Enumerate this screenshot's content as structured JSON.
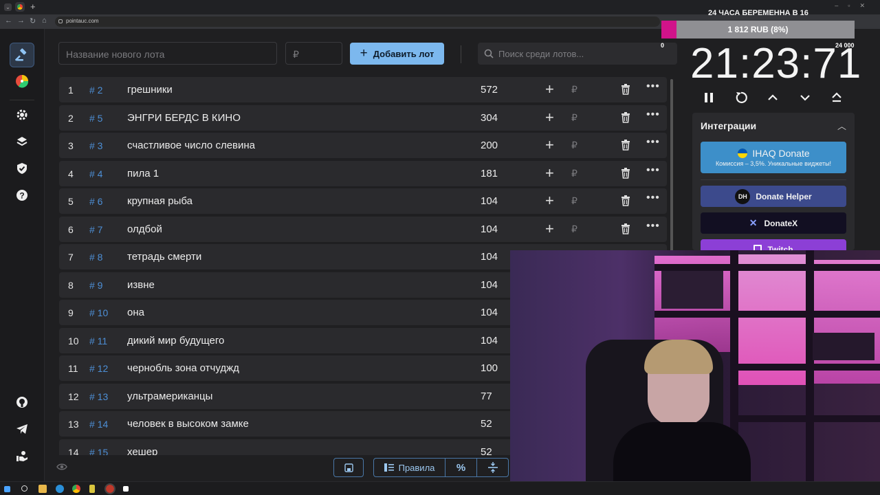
{
  "browser": {
    "url": "pointauc.com"
  },
  "toolbar": {
    "new_lot_placeholder": "Название нового лота",
    "price_placeholder": "₽",
    "add_button_label": "Добавить лот",
    "search_placeholder": "Поиск среди лотов..."
  },
  "lots": [
    {
      "index": "1",
      "tag": "# 2",
      "name": "грешники",
      "amount": "572"
    },
    {
      "index": "2",
      "tag": "# 5",
      "name": "ЭНГРИ БЕРДС В КИНО",
      "amount": "304"
    },
    {
      "index": "3",
      "tag": "# 3",
      "name": "счастливое число слевина",
      "amount": "200"
    },
    {
      "index": "4",
      "tag": "# 4",
      "name": "пила 1",
      "amount": "181"
    },
    {
      "index": "5",
      "tag": "# 6",
      "name": "крупная рыба",
      "amount": "104"
    },
    {
      "index": "6",
      "tag": "# 7",
      "name": "олдбой",
      "amount": "104"
    },
    {
      "index": "7",
      "tag": "# 8",
      "name": "тетрадь смерти",
      "amount": "104"
    },
    {
      "index": "8",
      "tag": "# 9",
      "name": "извне",
      "amount": "104"
    },
    {
      "index": "9",
      "tag": "# 10",
      "name": "она",
      "amount": "104"
    },
    {
      "index": "10",
      "tag": "# 11",
      "name": "дикий мир будущего",
      "amount": "104"
    },
    {
      "index": "11",
      "tag": "# 12",
      "name": "чернобль зона отчуджд",
      "amount": "100"
    },
    {
      "index": "12",
      "tag": "# 13",
      "name": "ультрамериканцы",
      "amount": "77"
    },
    {
      "index": "13",
      "tag": "# 14",
      "name": "человек в высоком замке",
      "amount": "52"
    },
    {
      "index": "14",
      "tag": "# 15",
      "name": "хешер",
      "amount": "52"
    }
  ],
  "row_actions": {
    "rub": "₽"
  },
  "bottom_bar": {
    "rules_label": "Правила",
    "percent_label": "%"
  },
  "timer": {
    "value": "21:23:71"
  },
  "integrations": {
    "title": "Интеграции",
    "ihaq_title": "IHAQ Donate",
    "ihaq_subtitle": "Комиссия – 3,5%. Уникальные виджеты!",
    "donate_helper": "Donate Helper",
    "donate_helper_logo": "DH",
    "donatex": "DonateX",
    "twitch": "Twitch"
  },
  "overlay": {
    "title": "24 ЧАСА БЕРЕМЕННА В 16",
    "amount_text": "1 812 RUB (8%)",
    "progress_fraction": 0.08,
    "min_label": "0",
    "max_label": "24 000"
  },
  "colors": {
    "accent": "#7cb8ee",
    "hash": "#4d8fd6",
    "overlay_fill": "#d0138a"
  }
}
